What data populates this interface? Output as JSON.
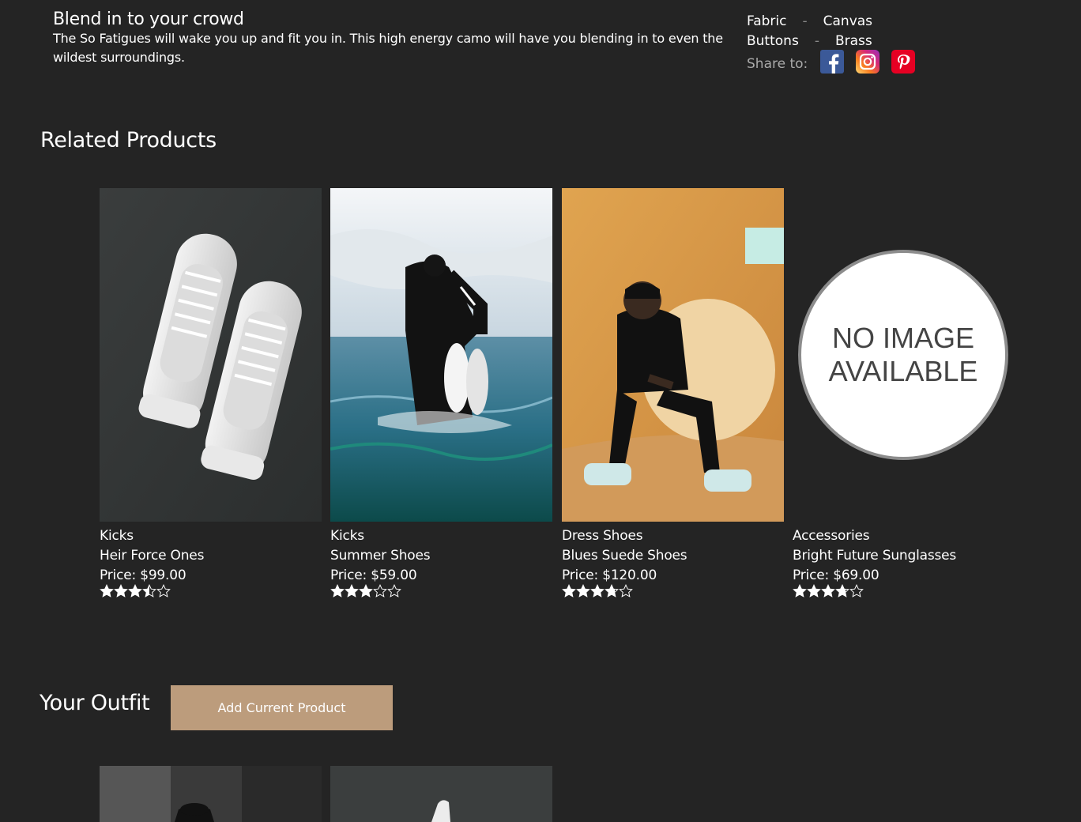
{
  "description": {
    "title": "Blend in to your crowd",
    "body": "The So Fatigues will wake you up and fit you in. This high energy camo will have you blending in to even the wildest surroundings."
  },
  "features": [
    {
      "name": "Fabric",
      "dash": "-",
      "value": "Canvas"
    },
    {
      "name": "Buttons",
      "dash": "-",
      "value": "Brass"
    }
  ],
  "share": {
    "label": "Share to:",
    "icons": [
      "facebook-icon",
      "instagram-icon",
      "pinterest-icon"
    ]
  },
  "related": {
    "title": "Related Products",
    "items": [
      {
        "category": "Kicks",
        "name": "Heir Force Ones",
        "price": "Price: $99.00",
        "rating": 3.5
      },
      {
        "category": "Kicks",
        "name": "Summer Shoes",
        "price": "Price: $59.00",
        "rating": 3
      },
      {
        "category": "Dress Shoes",
        "name": "Blues Suede Shoes",
        "price": "Price: $120.00",
        "rating": 3.75
      },
      {
        "category": "Accessories",
        "name": "Bright Future Sunglasses",
        "price": "Price: $69.00",
        "rating": 3.75,
        "no_image_text": "NO IMAGE AVAILABLE"
      }
    ]
  },
  "outfit": {
    "title": "Your Outfit",
    "add_label": "Add Current Product"
  },
  "colors": {
    "background": "#242424",
    "button": "#bc9c7c",
    "text": "#ffffff"
  }
}
